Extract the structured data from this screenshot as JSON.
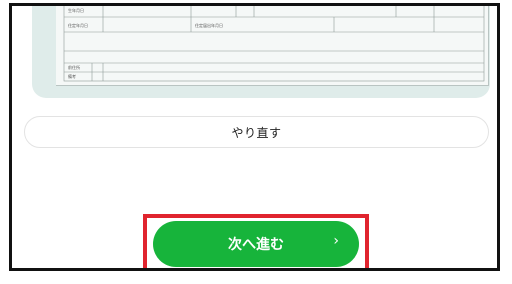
{
  "preview": {
    "form_labels": {
      "birth_date": "生年月日",
      "residence_start": "住定年月日",
      "residence_report": "住定届出年月日",
      "prev_address": "前住所",
      "remarks": "備考"
    }
  },
  "buttons": {
    "retry_label": "やり直す",
    "next_label": "次へ進む",
    "next_chevron": "›"
  },
  "colors": {
    "next_bg": "#17b43b",
    "highlight_border": "#e0242e",
    "preview_bg": "#dfecea"
  }
}
